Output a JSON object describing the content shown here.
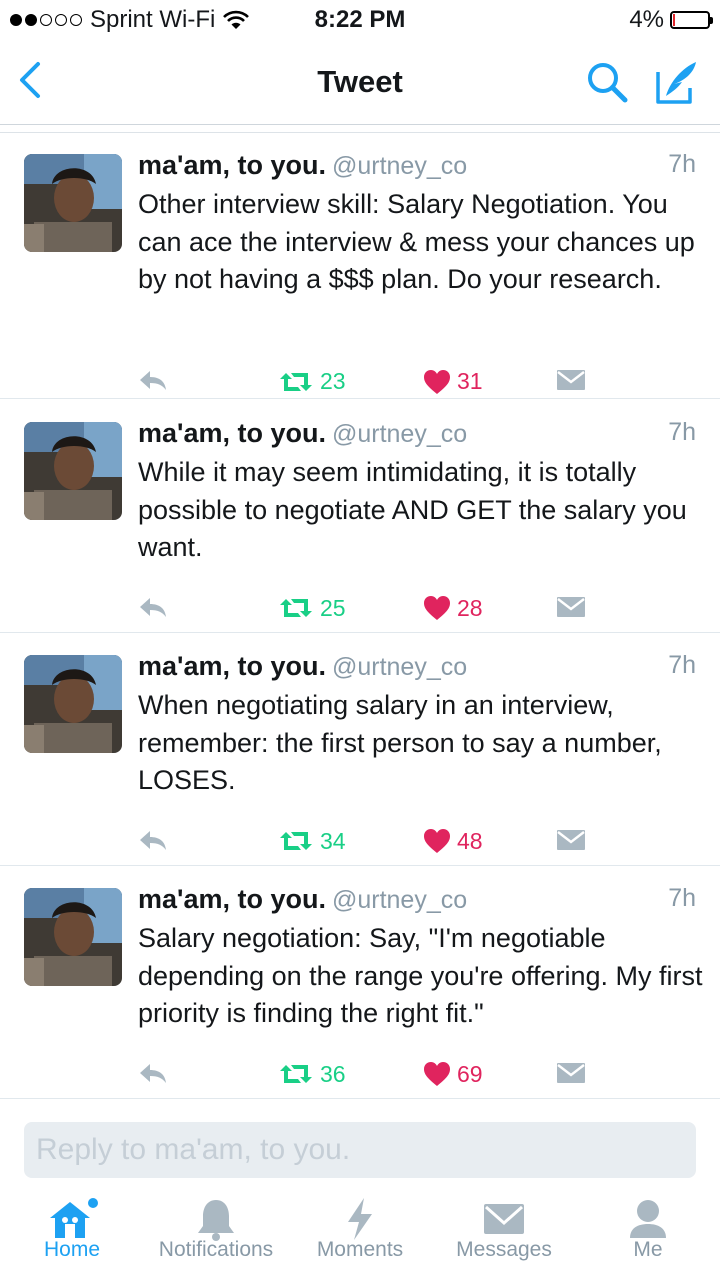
{
  "status_bar": {
    "carrier": "Sprint Wi-Fi",
    "time": "8:22 PM",
    "battery": "4%",
    "battery_level": 0.04
  },
  "nav": {
    "title": "Tweet"
  },
  "tweets": [
    {
      "name": "ma'am, to you.",
      "handle": "@urtney_co",
      "time": "7h",
      "text": "Other interview skill: Salary Negotiation. You can ace the interview & mess your chances up by not having a $$$ plan. Do your research.",
      "retweets": "23",
      "likes": "31"
    },
    {
      "name": "ma'am, to you.",
      "handle": "@urtney_co",
      "time": "7h",
      "text": "While it may seem intimidating, it is totally possible to negotiate AND GET the salary you want.",
      "retweets": "25",
      "likes": "28"
    },
    {
      "name": "ma'am, to you.",
      "handle": "@urtney_co",
      "time": "7h",
      "text": "When negotiating salary in an interview, remember: the first person to say a number, LOSES.",
      "retweets": "34",
      "likes": "48"
    },
    {
      "name": "ma'am, to you.",
      "handle": "@urtney_co",
      "time": "7h",
      "text": "Salary negotiation: Say, \"I'm negotiable depending on the range you're offering. My first priority is finding the right fit.\"",
      "retweets": "36",
      "likes": "69"
    }
  ],
  "reply": {
    "placeholder": "Reply to ma'am, to you."
  },
  "tabs": [
    {
      "label": "Home",
      "icon": "home-icon",
      "active": true
    },
    {
      "label": "Notifications",
      "icon": "bell-icon"
    },
    {
      "label": "Moments",
      "icon": "lightning-icon"
    },
    {
      "label": "Messages",
      "icon": "envelope-icon"
    },
    {
      "label": "Me",
      "icon": "person-icon"
    }
  ],
  "colors": {
    "accent": "#1da1f2",
    "retweet": "#19cf86",
    "like": "#e0245e",
    "muted": "#8899a6"
  }
}
